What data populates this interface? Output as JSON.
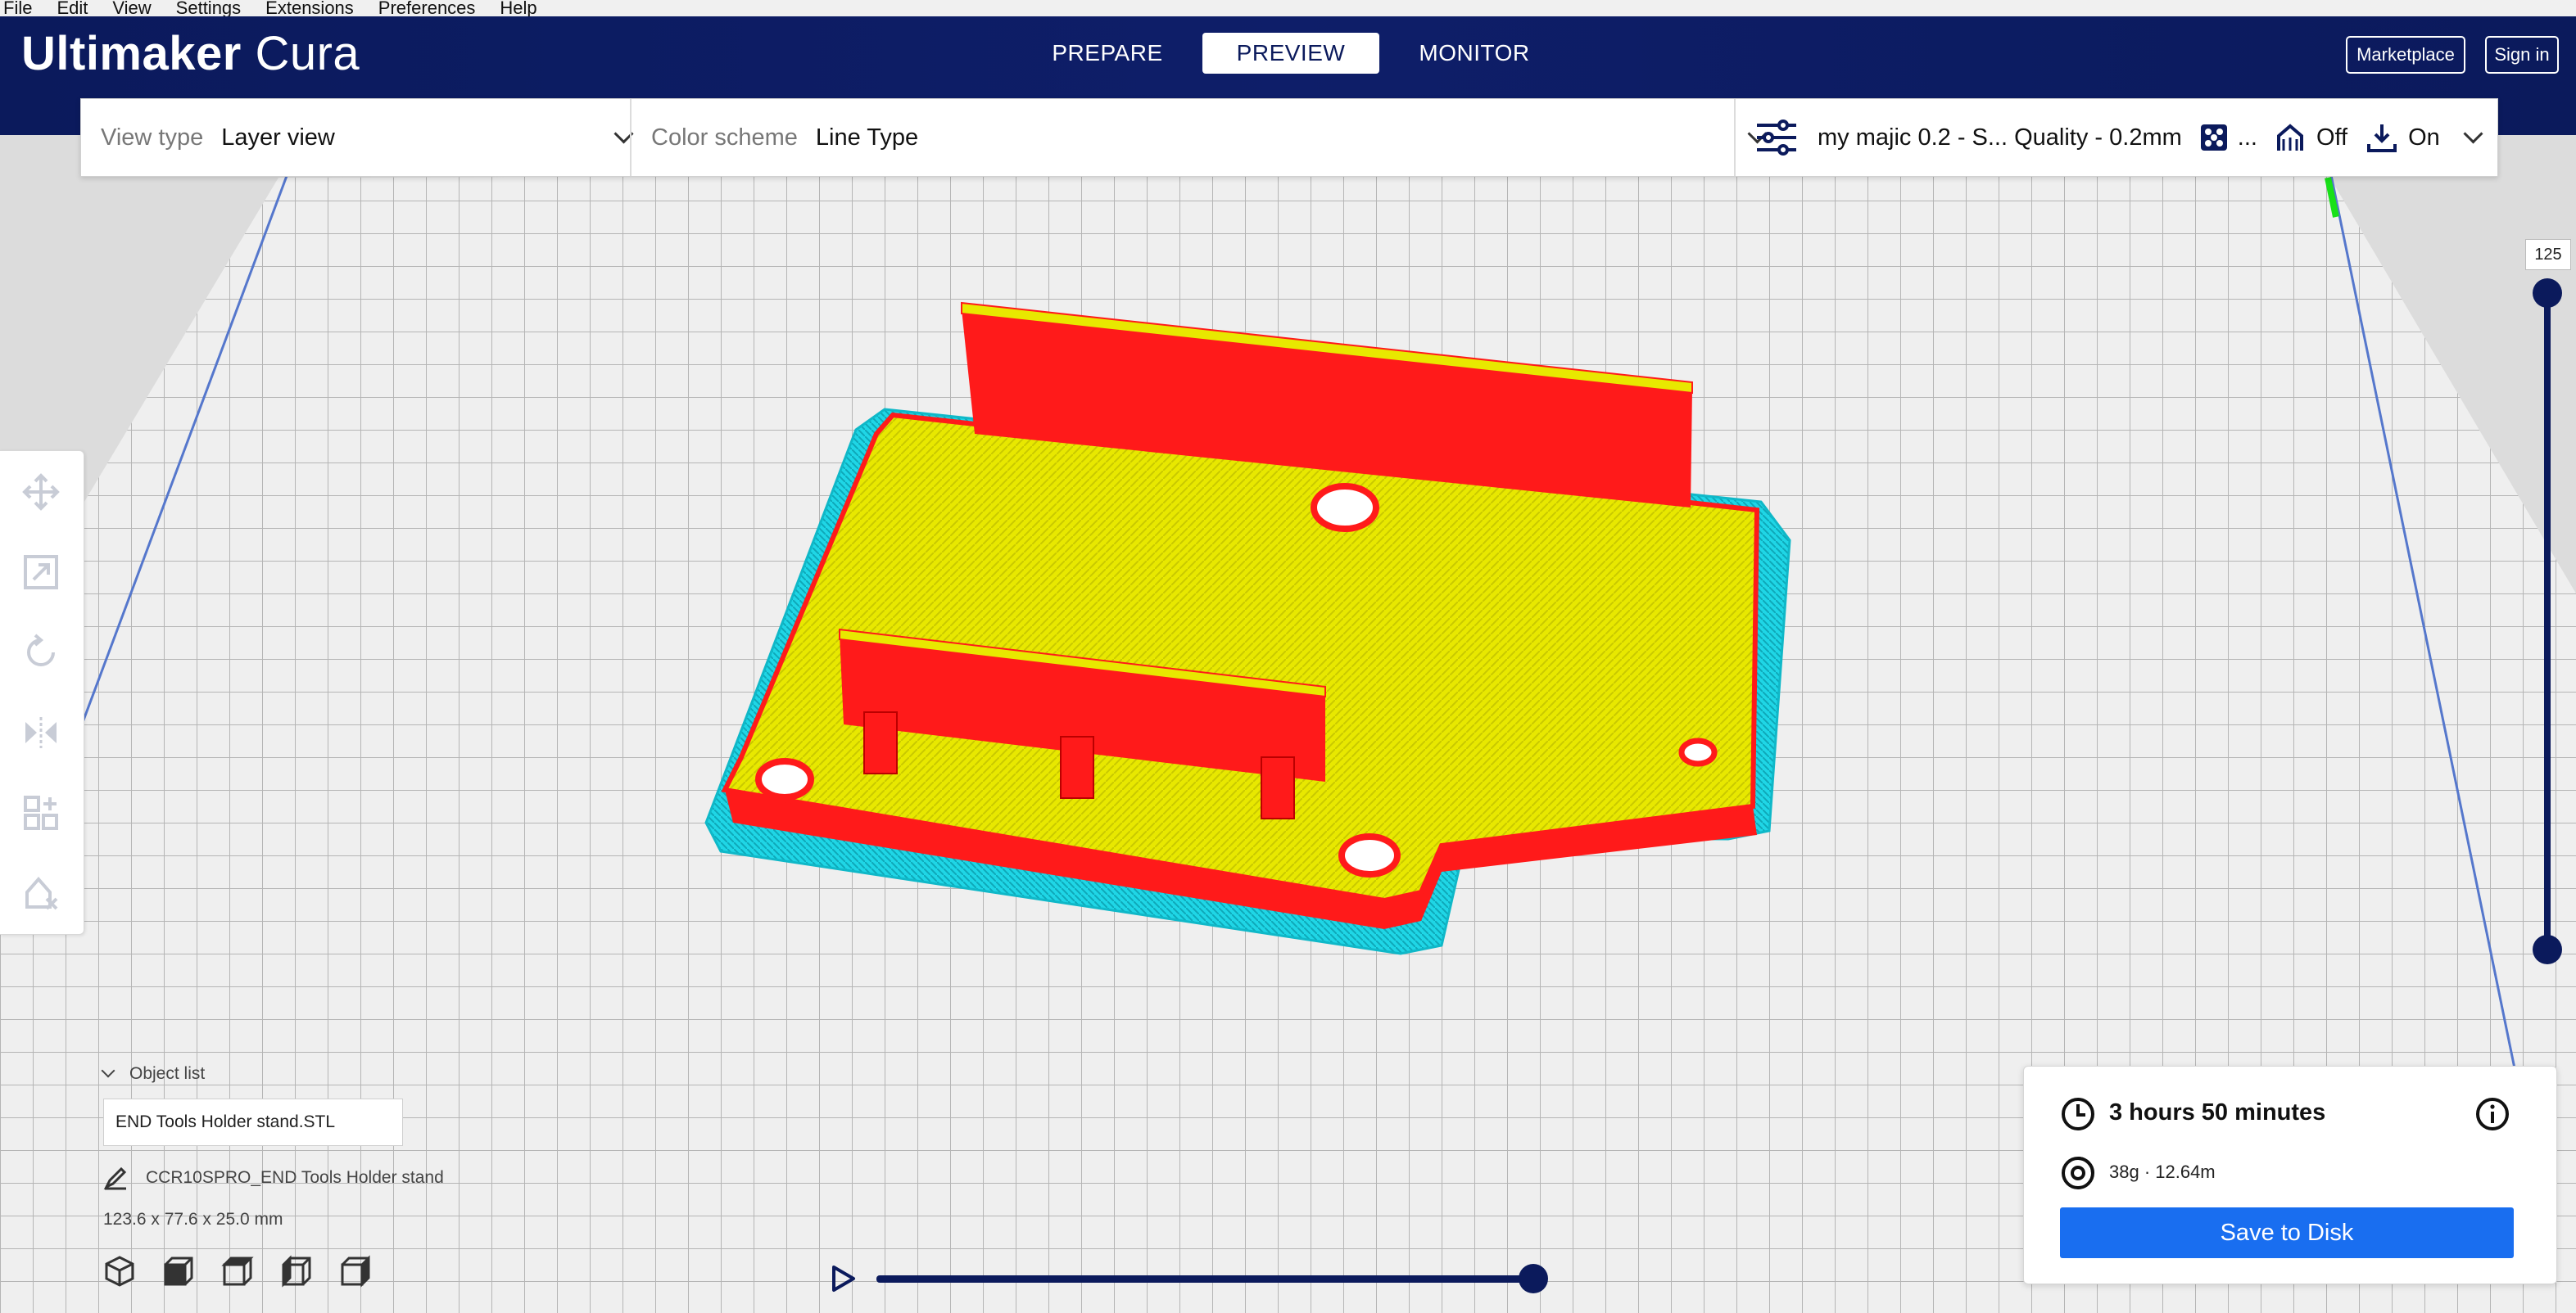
{
  "menu": [
    "File",
    "Edit",
    "View",
    "Settings",
    "Extensions",
    "Preferences",
    "Help"
  ],
  "app": {
    "logo_bold": "Ultimaker",
    "logo_light": "Cura"
  },
  "stages": [
    {
      "label": "PREPARE",
      "active": false
    },
    {
      "label": "PREVIEW",
      "active": true
    },
    {
      "label": "MONITOR",
      "active": false
    }
  ],
  "header_buttons": {
    "marketplace": "Marketplace",
    "signin": "Sign in"
  },
  "view": {
    "view_type_label": "View type",
    "view_type_value": "Layer view",
    "color_scheme_label": "Color scheme",
    "color_scheme_value": "Line Type"
  },
  "print_settings": {
    "profile": "my majic 0.2 - S... Quality - 0.2mm",
    "ellipsis": "...",
    "support": "Off",
    "adhesion": "On"
  },
  "toolbar_icons": [
    "move-icon",
    "scale-icon",
    "rotate-icon",
    "mirror-icon",
    "per-model-settings-icon",
    "support-blocker-icon"
  ],
  "object_list": {
    "header": "Object list",
    "filename": "END Tools Holder stand.STL",
    "job_name": "CCR10SPRO_END Tools Holder stand",
    "dimensions": "123.6 x 77.6 x 25.0 mm"
  },
  "layer_slider": {
    "current_layer": "125"
  },
  "print_info": {
    "time": "3 hours 50 minutes",
    "material": "38g · 12.64m",
    "save_label": "Save to Disk"
  },
  "colors": {
    "header": "#0b1a5c",
    "accent": "#196ef0",
    "wall_outer": "#ff1a1a",
    "skin": "#e6e600",
    "skirt": "#19d5e0",
    "travel_green": "#19e019"
  }
}
